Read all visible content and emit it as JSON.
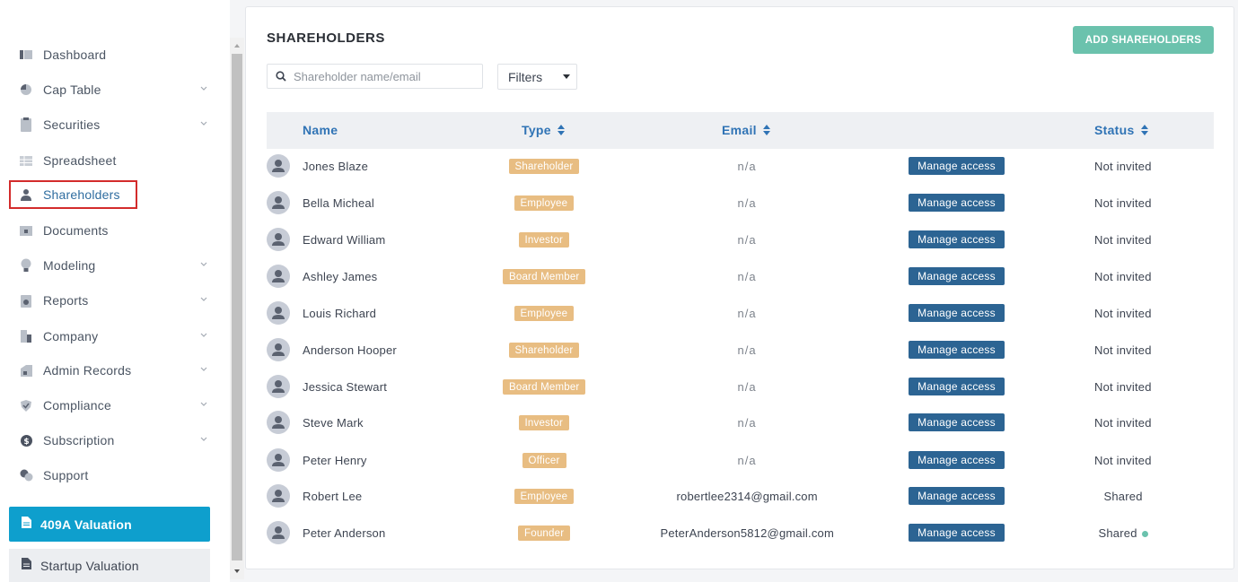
{
  "sidebar": {
    "items": [
      {
        "label": "Dashboard",
        "icon": "dashboard-icon",
        "expandable": false
      },
      {
        "label": "Cap Table",
        "icon": "pie-chart-icon",
        "expandable": true
      },
      {
        "label": "Securities",
        "icon": "clipboard-icon",
        "expandable": true
      },
      {
        "label": "Spreadsheet",
        "icon": "spreadsheet-icon",
        "expandable": false
      },
      {
        "label": "Shareholders",
        "icon": "user-icon",
        "expandable": false,
        "active": true
      },
      {
        "label": "Documents",
        "icon": "folder-icon",
        "expandable": false
      },
      {
        "label": "Modeling",
        "icon": "lightbulb-icon",
        "expandable": true
      },
      {
        "label": "Reports",
        "icon": "report-icon",
        "expandable": true
      },
      {
        "label": "Company",
        "icon": "building-icon",
        "expandable": true
      },
      {
        "label": "Admin Records",
        "icon": "records-icon",
        "expandable": true
      },
      {
        "label": "Compliance",
        "icon": "shield-check-icon",
        "expandable": true
      },
      {
        "label": "Subscription",
        "icon": "dollar-icon",
        "expandable": true
      },
      {
        "label": "Support",
        "icon": "support-icon",
        "expandable": false
      }
    ],
    "valuation_label": "409A Valuation",
    "startup_label": "Startup Valuation"
  },
  "page": {
    "title": "SHAREHOLDERS",
    "add_button": "ADD SHAREHOLDERS",
    "search_placeholder": "Shareholder name/email",
    "filters_label": "Filters"
  },
  "table": {
    "headers": {
      "name": "Name",
      "type": "Type",
      "email": "Email",
      "status": "Status"
    },
    "manage_label": "Manage access",
    "rows": [
      {
        "name": "Jones Blaze",
        "type": "Shareholder",
        "email": "n/a",
        "status": "Not invited"
      },
      {
        "name": "Bella Micheal",
        "type": "Employee",
        "email": "n/a",
        "status": "Not invited"
      },
      {
        "name": "Edward William",
        "type": "Investor",
        "email": "n/a",
        "status": "Not invited"
      },
      {
        "name": "Ashley James",
        "type": "Board Member",
        "email": "n/a",
        "status": "Not invited"
      },
      {
        "name": "Louis Richard",
        "type": "Employee",
        "email": "n/a",
        "status": "Not invited"
      },
      {
        "name": "Anderson Hooper",
        "type": "Shareholder",
        "email": "n/a",
        "status": "Not invited"
      },
      {
        "name": "Jessica Stewart",
        "type": "Board Member",
        "email": "n/a",
        "status": "Not invited"
      },
      {
        "name": "Steve Mark",
        "type": "Investor",
        "email": "n/a",
        "status": "Not invited"
      },
      {
        "name": "Peter Henry",
        "type": "Officer",
        "email": "n/a",
        "status": "Not invited"
      },
      {
        "name": "Robert Lee",
        "type": "Employee",
        "email": "robertlee2314@gmail.com",
        "status": "Shared"
      },
      {
        "name": "Peter Anderson",
        "type": "Founder",
        "email": "PeterAnderson5812@gmail.com",
        "status": "Shared",
        "online": true
      }
    ]
  },
  "colors": {
    "accent": "#2f73b5",
    "badge": "#e8bd82",
    "manage": "#2c6493",
    "add_button": "#6bc2ad",
    "valuation": "#0e9fcd",
    "active_outline": "#d32b2b"
  }
}
